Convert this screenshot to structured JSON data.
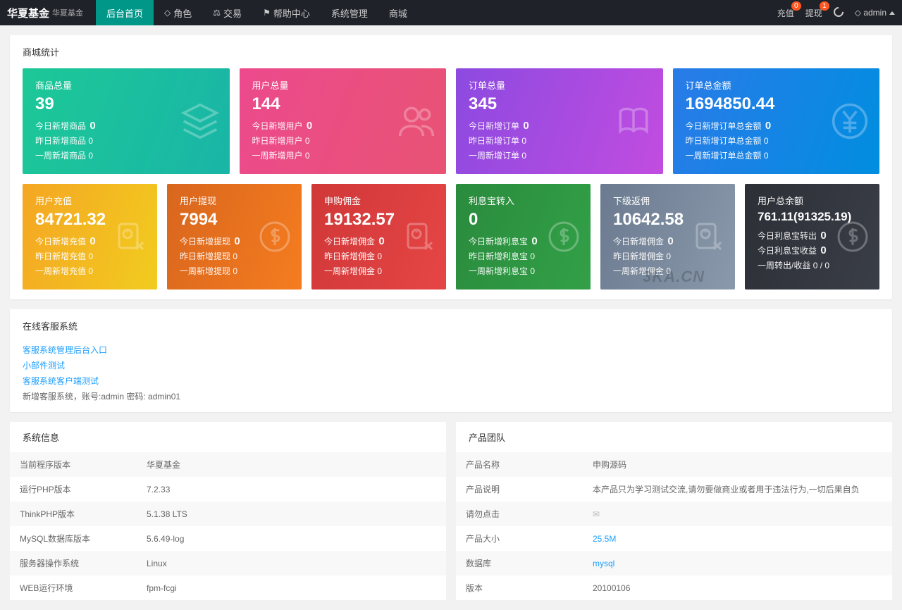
{
  "brand": "华夏基金",
  "brand_sub": "华夏基金",
  "nav": [
    "后台首页",
    "角色",
    "交易",
    "帮助中心",
    "系统管理",
    "商城"
  ],
  "topright": {
    "recharge": "充值",
    "withdraw": "提现",
    "badge_recharge": "0",
    "badge_withdraw": "1",
    "user": "admin"
  },
  "mall_title": "商城统计",
  "row1": [
    {
      "label": "商品总量",
      "big": "39",
      "l1": "今日新增商品",
      "v1": "0",
      "l2": "昨日新增商品",
      "v2": "0",
      "l3": "一周新增商品",
      "v3": "0"
    },
    {
      "label": "用户总量",
      "big": "144",
      "l1": "今日新增用户",
      "v1": "0",
      "l2": "昨日新增用户",
      "v2": "0",
      "l3": "一周新增用户",
      "v3": "0"
    },
    {
      "label": "订单总量",
      "big": "345",
      "l1": "今日新增订单",
      "v1": "0",
      "l2": "昨日新增订单",
      "v2": "0",
      "l3": "一周新增订单",
      "v3": "0"
    },
    {
      "label": "订单总金额",
      "big": "1694850.44",
      "l1": "今日新增订单总金额",
      "v1": "0",
      "l2": "昨日新增订单总金额",
      "v2": "0",
      "l3": "一周新增订单总金额",
      "v3": "0"
    }
  ],
  "row2": [
    {
      "label": "用户充值",
      "big": "84721.32",
      "l1": "今日新增充值",
      "v1": "0",
      "l2": "昨日新增充值",
      "v2": "0",
      "l3": "一周新增充值",
      "v3": "0"
    },
    {
      "label": "用户提现",
      "big": "7994",
      "l1": "今日新增提现",
      "v1": "0",
      "l2": "昨日新增提现",
      "v2": "0",
      "l3": "一周新增提现",
      "v3": "0"
    },
    {
      "label": "申购佣金",
      "big": "19132.57",
      "l1": "今日新增佣金",
      "v1": "0",
      "l2": "昨日新增佣金",
      "v2": "0",
      "l3": "一周新增佣金",
      "v3": "0"
    },
    {
      "label": "利息宝转入",
      "big": "0",
      "l1": "今日新增利息宝",
      "v1": "0",
      "l2": "昨日新增利息宝",
      "v2": "0",
      "l3": "一周新增利息宝",
      "v3": "0"
    },
    {
      "label": "下级返佣",
      "big": "10642.58",
      "l1": "今日新增佣金",
      "v1": "0",
      "l2": "昨日新增佣金",
      "v2": "0",
      "l3": "一周新增佣金",
      "v3": "0"
    },
    {
      "label": "用户总余额",
      "big": "761.11(91325.19)",
      "l1": "今日利息宝转出",
      "v1": "0",
      "l2": "今日利息宝收益",
      "v2": "0",
      "l3": "一周转出/收益",
      "v3": "0 / 0"
    }
  ],
  "service": {
    "title": "在线客服系统",
    "links": [
      "客服系统管理后台入口",
      "小部件测试",
      "客服系统客户端测试"
    ],
    "hint": "新增客服系统，账号:admin 密码: admin01"
  },
  "sys": {
    "title": "系统信息",
    "rows": [
      [
        "当前程序版本",
        "华夏基金"
      ],
      [
        "运行PHP版本",
        "7.2.33"
      ],
      [
        "ThinkPHP版本",
        "5.1.38 LTS"
      ],
      [
        "MySQL数据库版本",
        "5.6.49-log"
      ],
      [
        "服务器操作系统",
        "Linux"
      ],
      [
        "WEB运行环境",
        "fpm-fcgi"
      ]
    ]
  },
  "team": {
    "title": "产品团队",
    "rows": [
      [
        "产品名称",
        "申购源码"
      ],
      [
        "产品说明",
        "本产品只为学习测试交流,请勿要做商业或者用于违法行为,一切后果自负"
      ],
      [
        "请勿点击",
        "✉"
      ],
      [
        "产品大小",
        "25.5M"
      ],
      [
        "数据库",
        "mysql"
      ],
      [
        "版本",
        "20100106"
      ]
    ]
  },
  "watermark": "3KA.CN"
}
